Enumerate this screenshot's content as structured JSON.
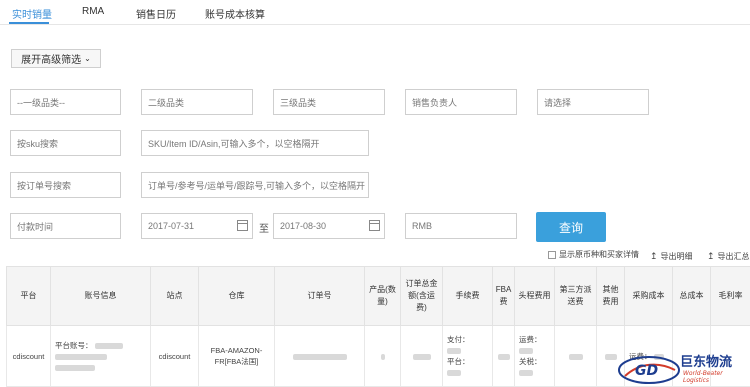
{
  "tabs": [
    {
      "label": "实时销量",
      "active": true
    },
    {
      "label": "RMA",
      "active": false
    },
    {
      "label": "销售日历",
      "active": false
    },
    {
      "label": "账号成本核算",
      "active": false
    }
  ],
  "filters": {
    "advanced_toggle": "展开高级筛选",
    "category1": "--一级品类--",
    "category2": "二级品类",
    "category3": "三级品类",
    "sales_owner": "销售负责人",
    "select": "请选择",
    "sku_search": "按sku搜索",
    "sku_placeholder": "SKU/Item ID/Asin,可输入多个，以空格隔开",
    "order_search": "按订单号搜索",
    "order_placeholder": "订单号/参考号/运单号/跟踪号,可输入多个，以空格隔开",
    "time_type": "付款时间",
    "date_from": "2017-07-31",
    "date_sep": "至",
    "date_to": "2017-08-30",
    "currency": "RMB",
    "query_button": "查询",
    "show_currency_detail": "显示原币种和买家详情",
    "export_detail": "导出明细",
    "export_summary": "导出汇总"
  },
  "table": {
    "headers": [
      "平台",
      "账号信息",
      "站点",
      "仓库",
      "订单号",
      "产品(数量)",
      "订单总金额(含运费)",
      "手续费",
      "FBA费",
      "头程费用",
      "第三方派送费",
      "其他费用",
      "采购成本",
      "总成本",
      "毛利率"
    ],
    "row": {
      "platform": "cdiscount",
      "account_label": "平台账号：",
      "site": "cdiscount",
      "warehouse": "FBA-AMAZON-FR[FBA法国]",
      "fee_pay": "支付：",
      "fee_platform": "平台：",
      "head_freight": "运费：",
      "head_tariff": "关税：",
      "purchase_freight": "运费："
    }
  },
  "logo": {
    "name": "巨东物流",
    "tagline": "World-Beater Logistics"
  }
}
